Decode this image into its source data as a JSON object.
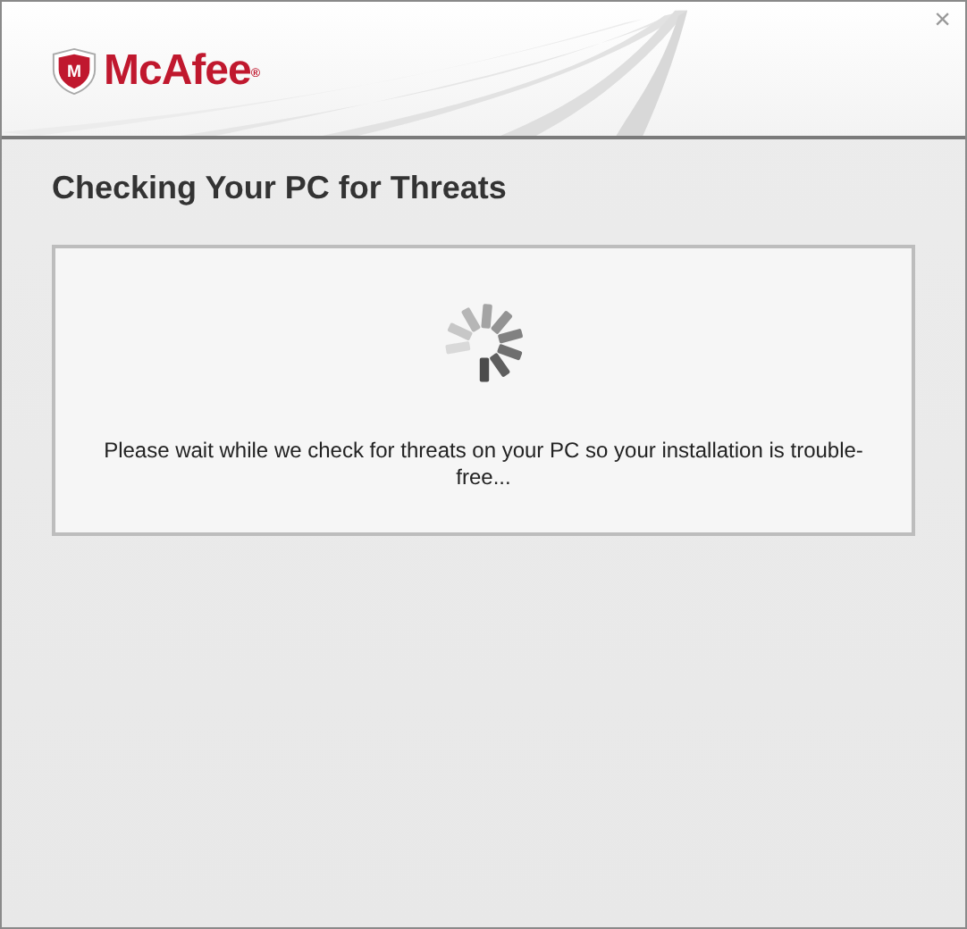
{
  "window": {
    "close": "×"
  },
  "logo": {
    "text": "McAfee",
    "mark": "®",
    "shield": "M"
  },
  "title": "Checking Your PC for Threats",
  "panel": {
    "message": "Please wait while we check for threats on your PC so your installation is trouble-free..."
  }
}
